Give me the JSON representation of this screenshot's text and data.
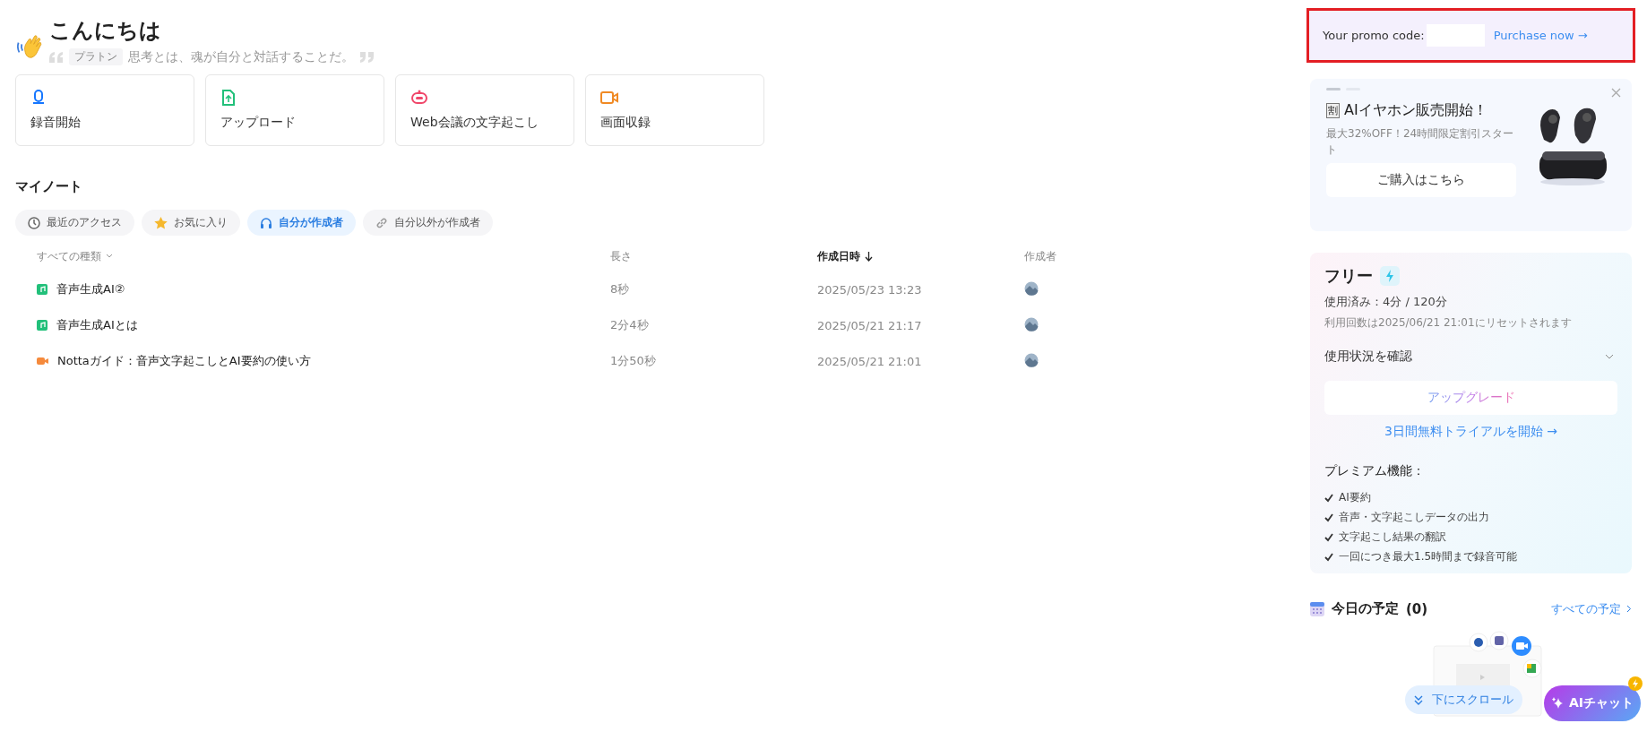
{
  "greeting": {
    "title": "こんにちは",
    "quote_author": "プラトン",
    "quote": "思考とは、魂が自分と対話することだ。"
  },
  "quick_actions": [
    {
      "kind": "record",
      "label": "録音開始"
    },
    {
      "kind": "upload",
      "label": "アップロード"
    },
    {
      "kind": "meeting",
      "label": "Web会議の文字起こし"
    },
    {
      "kind": "screen",
      "label": "画面収録"
    }
  ],
  "notes": {
    "title": "マイノート",
    "tabs": [
      {
        "kind": "recent",
        "label": "最近のアクセス",
        "selected": false
      },
      {
        "kind": "favorite",
        "label": "お気に入り",
        "selected": false
      },
      {
        "kind": "mine",
        "label": "自分が作成者",
        "selected": true
      },
      {
        "kind": "shared",
        "label": "自分以外が作成者",
        "selected": false
      }
    ],
    "columns": [
      {
        "label": "すべての種類",
        "sorted": false,
        "dropdown": true
      },
      {
        "label": "長さ",
        "sorted": false,
        "dropdown": false
      },
      {
        "label": "作成日時",
        "sorted": true,
        "dropdown": false
      },
      {
        "label": "作成者",
        "sorted": false,
        "dropdown": false
      }
    ],
    "rows": [
      {
        "kind": "audio",
        "name": "音声生成AI②",
        "length": "8秒",
        "created": "2025/05/23 13:23"
      },
      {
        "kind": "audio",
        "name": "音声生成AIとは",
        "length": "2分4秒",
        "created": "2025/05/21 21:17"
      },
      {
        "kind": "video",
        "name": "Nottaガイド：音声文字起こしとAI要約の使い方",
        "length": "1分50秒",
        "created": "2025/05/21 21:01"
      }
    ]
  },
  "promo": {
    "label": "Your promo code:",
    "link": "Purchase now →"
  },
  "ad": {
    "carousel": [
      {
        "selected": true
      },
      {
        "selected": false
      }
    ],
    "badge": "割",
    "title": "AIイヤホン販売開始！",
    "text": "最大32%OFF！24時間限定割引スタート",
    "button": "ご購入はこちら"
  },
  "plan": {
    "name": "フリー",
    "usage": "使用済み：4分 / 120分",
    "reset": "利用回数は2025/06/21 21:01にリセットされます",
    "usage_toggle": "使用状況を確認",
    "expanded": false,
    "upgrade": "アップグレード",
    "trial": "3日間無料トライアルを開始 →",
    "features_title": "プレミアム機能：",
    "features": [
      "AI要約",
      "音声・文字起こしデータの出力",
      "文字起こし結果の翻訳",
      "一回につき最大1.5時間まで録音可能"
    ]
  },
  "schedule": {
    "title": "今日の予定",
    "count": "(0)",
    "link": "すべての予定"
  },
  "scroll_button": "下にスクロール",
  "chat_button": "AIチャット"
}
